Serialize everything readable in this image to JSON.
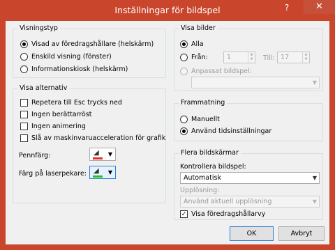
{
  "window": {
    "title": "Inställningar för bildspel",
    "help_glyph": "?",
    "close_glyph": "✕"
  },
  "visningstyp": {
    "title": "Visningstyp",
    "options": [
      {
        "label": "Visad av föredragshållare (helskärm)",
        "selected": true
      },
      {
        "label": "Enskild visning (fönster)",
        "selected": false
      },
      {
        "label": "Informationskiosk (helskärm)",
        "selected": false
      }
    ]
  },
  "visa_alternativ": {
    "title": "Visa alternativ",
    "checkboxes": [
      {
        "label": "Repetera till Esc trycks ned",
        "checked": false
      },
      {
        "label": "Ingen berättarröst",
        "checked": false
      },
      {
        "label": "Ingen animering",
        "checked": false
      },
      {
        "label": "Slå av maskinvaruacceleration för grafik",
        "checked": false
      }
    ],
    "pen_color_label": "Pennfärg:",
    "pen_color": "#e03030",
    "laser_color_label": "Färg på laserpekare:",
    "laser_color": "#22c022"
  },
  "visa_bilder": {
    "title": "Visa bilder",
    "all_label": "Alla",
    "from_label": "Från:",
    "from_value": "1",
    "to_label": "Till:",
    "to_value": "17",
    "custom_label": "Anpassat bildspel:",
    "custom_value": ""
  },
  "frammatning": {
    "title": "Frammatning",
    "manual_label": "Manuellt",
    "timings_label": "Använd tidsinställningar"
  },
  "flera_bildskarmar": {
    "title": "Flera bildskärmar",
    "monitor_label": "Kontrollera bildspel:",
    "monitor_value": "Automatisk",
    "resolution_label": "Upplösning:",
    "resolution_value": "Använd aktuell upplösning",
    "presenter_view_label": "Visa föredragshållarvy",
    "presenter_view_checked": true
  },
  "buttons": {
    "ok": "OK",
    "cancel": "Avbryt"
  }
}
